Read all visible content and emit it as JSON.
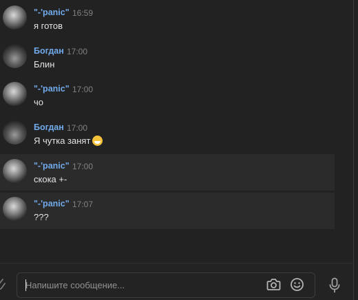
{
  "messages": [
    {
      "author": "\"-'panic\"",
      "time": "16:59",
      "text": "я готов",
      "highlighted": false
    },
    {
      "author": "Богдан",
      "time": "17:00",
      "text": "Блин",
      "highlighted": false
    },
    {
      "author": "\"-'panic\"",
      "time": "17:00",
      "text": "чо",
      "highlighted": false
    },
    {
      "author": "Богдан",
      "time": "17:00",
      "text": "Я чутка занят",
      "emoji": "grinning-face",
      "highlighted": false
    },
    {
      "author": "\"-'panic\"",
      "time": "17:00",
      "text": "скока +-",
      "highlighted": true
    },
    {
      "author": "\"-'panic\"",
      "time": "17:07",
      "text": "???",
      "highlighted": true
    }
  ],
  "composer": {
    "placeholder": "Напишите сообщение...",
    "icons": [
      "attach-icon",
      "camera-icon",
      "emoji-icon",
      "microphone-icon"
    ]
  },
  "colors": {
    "background": "#222222",
    "author": "#71aaeb",
    "time": "#828282",
    "highlight": "#2b2b2b"
  }
}
